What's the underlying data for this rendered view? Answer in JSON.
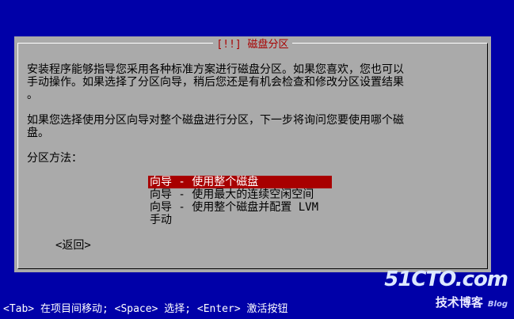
{
  "dialog": {
    "title": "[!!] 磁盘分区",
    "paragraph1": "安装程序能够指导您采用各种标准方案进行磁盘分区。如果您喜欢，您也可以\n手动操作。如果选择了分区向导，稍后您还是有机会检查和修改分区设置结果\n。",
    "paragraph2": "如果您选择使用分区向导对整个磁盘进行分区，下一步将询问您要使用哪个磁\n盘。",
    "method_label": "分区方法：",
    "options": [
      {
        "label": "向导 - 使用整个磁盘",
        "selected": true
      },
      {
        "label": "向导 - 使用最大的连续空闲空间",
        "selected": false
      },
      {
        "label": "向导 - 使用整个磁盘并配置 LVM",
        "selected": false
      },
      {
        "label": "手动",
        "selected": false
      }
    ],
    "back_label": "<返回>"
  },
  "status_bar": {
    "text": "<Tab> 在项目间移动; <Space> 选择; <Enter> 激活按钮"
  },
  "watermark": {
    "main": "51CTO.com",
    "sub": "技术博客",
    "blog": "Blog"
  },
  "colors": {
    "screen_bg": "#0000a8",
    "dialog_bg": "#aaaaaa",
    "title_fg": "#a80000",
    "selected_bg": "#a80000",
    "selected_fg": "#ffffff"
  }
}
